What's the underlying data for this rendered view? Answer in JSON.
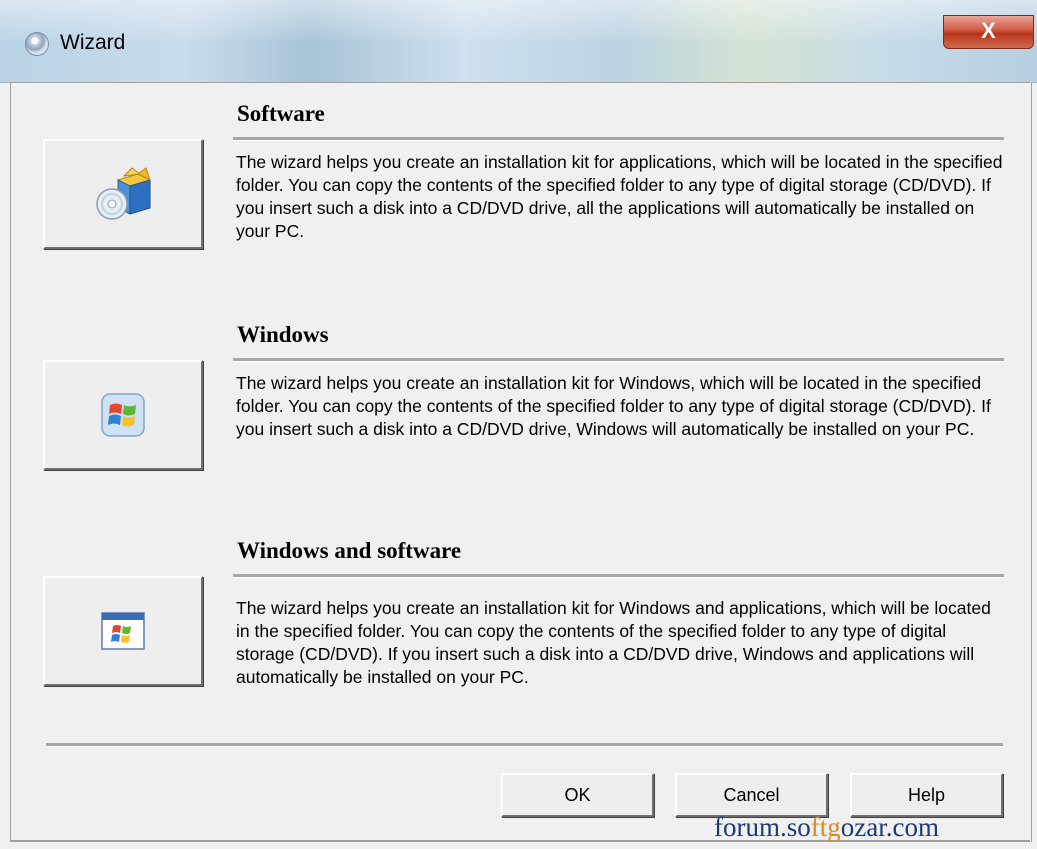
{
  "window": {
    "title": "Wizard",
    "close_label": "X"
  },
  "sections": [
    {
      "title": "Software",
      "description": "The wizard helps you create an installation kit for applications, which will be located in the specified folder. You can copy the contents of the specified folder to any type of digital storage (CD/DVD). If you insert such a disk into a CD/DVD drive, all the applications will automatically be installed on your PC.",
      "icon": "software-box-cd-icon"
    },
    {
      "title": "Windows",
      "description": "The wizard helps you create an installation kit for Windows, which will be located in the specified folder. You can copy the contents of the specified folder to any type of digital storage (CD/DVD). If you insert such a disk into a CD/DVD drive, Windows will automatically be installed on your PC.",
      "icon": "windows-logo-icon"
    },
    {
      "title": "Windows and software",
      "description": "The wizard helps you create an installation kit for Windows and applications, which will be located in the specified folder. You can copy the contents of the specified folder to any type of digital storage (CD/DVD). If you insert such a disk into a CD/DVD drive, Windows and applications will automatically be installed on your PC.",
      "icon": "windows-window-icon"
    }
  ],
  "buttons": {
    "ok": "OK",
    "cancel": "Cancel",
    "help": "Help"
  },
  "watermark": {
    "part1": "forum.so",
    "part2": "ft",
    "part3": "g",
    "part4": "ozar.com"
  },
  "colors": {
    "close_button": "#c8452c",
    "watermark_blue": "#1a3a78",
    "watermark_orange": "#e08a1e"
  }
}
